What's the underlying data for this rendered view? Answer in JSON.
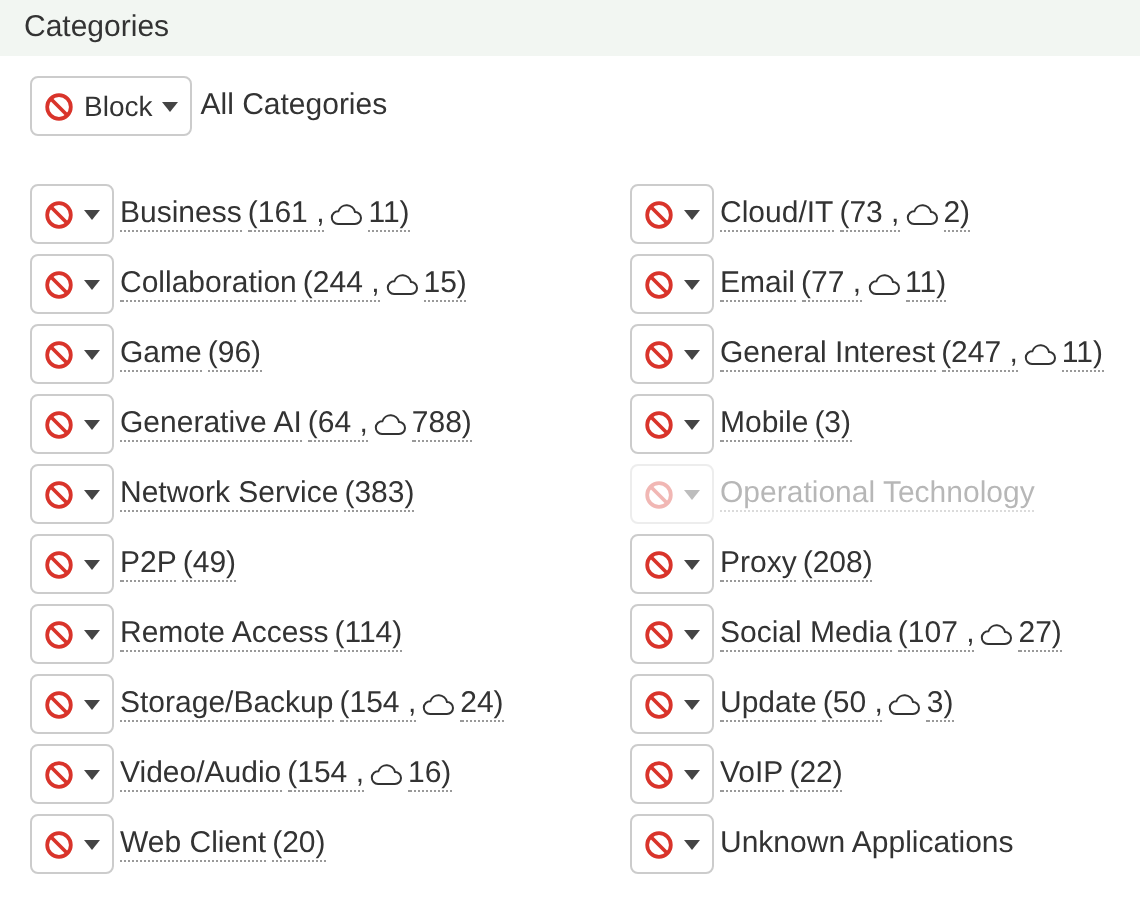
{
  "header": {
    "title": "Categories"
  },
  "all": {
    "action": "Block",
    "label": "All Categories"
  },
  "categories": [
    {
      "name": "Business",
      "count": "(161 ,",
      "cloud": "11)",
      "disabled": false
    },
    {
      "name": "Cloud/IT",
      "count": "(73 ,",
      "cloud": "2)",
      "disabled": false
    },
    {
      "name": "Collaboration",
      "count": "(244 ,",
      "cloud": "15)",
      "disabled": false
    },
    {
      "name": "Email",
      "count": "(77 ,",
      "cloud": "11)",
      "disabled": false
    },
    {
      "name": "Game",
      "count": "(96)",
      "disabled": false
    },
    {
      "name": "General Interest",
      "count": "(247 ,",
      "cloud": "11)",
      "disabled": false
    },
    {
      "name": "Generative AI",
      "count": "(64 ,",
      "cloud": "788)",
      "disabled": false
    },
    {
      "name": "Mobile",
      "count": "(3)",
      "disabled": false
    },
    {
      "name": "Network Service",
      "count": "(383)",
      "disabled": false
    },
    {
      "name": "Operational Technology",
      "disabled": true
    },
    {
      "name": "P2P",
      "count": "(49)",
      "disabled": false
    },
    {
      "name": "Proxy",
      "count": "(208)",
      "disabled": false
    },
    {
      "name": "Remote Access",
      "count": "(114)",
      "disabled": false
    },
    {
      "name": "Social Media",
      "count": "(107 ,",
      "cloud": "27)",
      "disabled": false
    },
    {
      "name": "Storage/Backup",
      "count": "(154 ,",
      "cloud": "24)",
      "disabled": false
    },
    {
      "name": "Update",
      "count": "(50 ,",
      "cloud": "3)",
      "disabled": false
    },
    {
      "name": "Video/Audio",
      "count": "(154 ,",
      "cloud": "16)",
      "disabled": false
    },
    {
      "name": "VoIP",
      "count": "(22)",
      "disabled": false
    },
    {
      "name": "Web Client",
      "count": "(20)",
      "disabled": false
    },
    {
      "name": "Unknown Applications",
      "plain": true,
      "disabled": false
    }
  ]
}
